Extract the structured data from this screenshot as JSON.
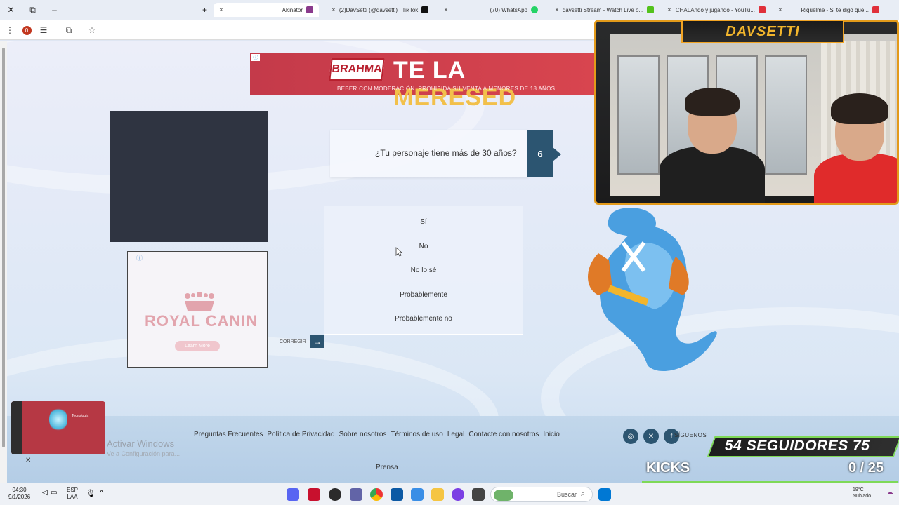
{
  "browser": {
    "tabs": [
      {
        "title": "Riquelme - Si te digo que...",
        "color": "#e0303a"
      },
      {
        "title": "CHALAndo y jugando - YouTu...",
        "color": "#e0303a"
      },
      {
        "title": "davsetti Stream - Watch Live o...",
        "color": "#53c21b"
      },
      {
        "title": "(70) WhatsApp",
        "color": "#25d366"
      },
      {
        "title": "(2)DavSetti (@davsetti) | TikTok",
        "color": "#111111"
      },
      {
        "title": "Akinator",
        "color": "#8a3a8c"
      }
    ],
    "new_tab": "+",
    "close": "×"
  },
  "ad_banner": {
    "brand": "BRAHMA",
    "headline_a": "TE LA ",
    "headline_b": "MERESED",
    "disclaimer": "BEBER CON MODERACIÓN. PROHIBIDA SU VENTA A MENORES DE 18 AÑOS."
  },
  "royal_canin": {
    "brand": "ROYAL CANIN",
    "button": "Learn More",
    "info": "ⓘ"
  },
  "question": {
    "number": "6",
    "text": "¿Tu personaje tiene más de 30 años?"
  },
  "answers": [
    "Sí",
    "No",
    "No lo sé",
    "Probablemente",
    "Probablemente no"
  ],
  "correct_label": "CORREGIR",
  "footer": {
    "links": [
      "Inicio",
      "Contacte con nosotros",
      "Legal",
      "Términos de uso",
      "Sobre nosotros",
      "Política de Privacidad",
      "Preguntas Frecuentes"
    ],
    "press": "Prensa",
    "follow": "SÍGUENOS"
  },
  "windows_watermark": {
    "title": "Activar Windows",
    "subtitle": "Ve a Configuración para..."
  },
  "stream": {
    "streamer": "DAVSETTI",
    "followers": "54 SEGUIDORES 75",
    "kicks_label": "KICKS",
    "kicks_count": "0 / 25",
    "kicks_progress": 0
  },
  "mini_player": {
    "label": "Tecnología"
  },
  "taskbar": {
    "search": "Buscar",
    "time": "04:30",
    "date": "9/1/2026",
    "lang_a": "ESP",
    "lang_b": "LAA",
    "weather_temp": "19°C",
    "weather_desc": "Nublado"
  }
}
